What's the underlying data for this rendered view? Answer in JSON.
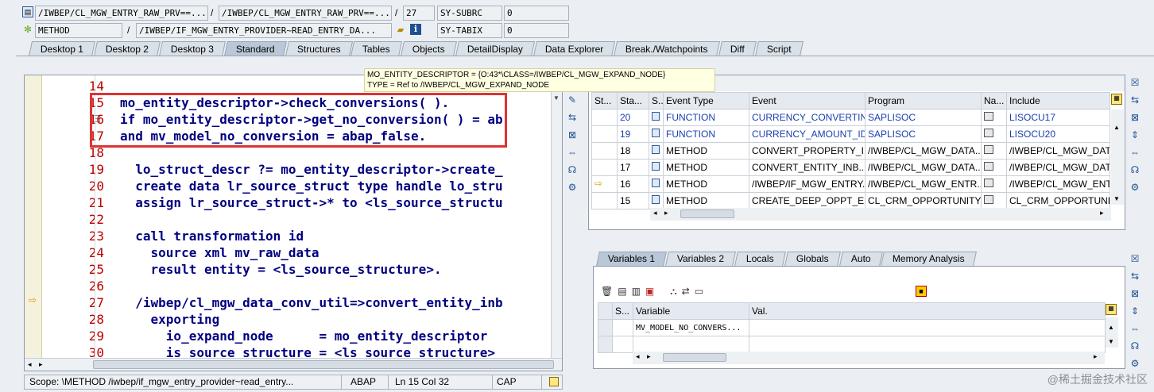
{
  "header": {
    "row1": {
      "program": "/IWBEP/CL_MGW_ENTRY_RAW_PRV==...",
      "include": "/IWBEP/CL_MGW_ENTRY_RAW_PRV==...",
      "line": "27",
      "sysvar": "SY-SUBRC",
      "sysval": "0"
    },
    "row2": {
      "type": "METHOD",
      "name": "/IWBEP/IF_MGW_ENTRY_PROVIDER~READ_ENTRY_DA...",
      "sysvar": "SY-TABIX",
      "sysval": "0"
    },
    "slash": "/"
  },
  "tabs": [
    "Desktop 1",
    "Desktop 2",
    "Desktop 3",
    "Standard",
    "Structures",
    "Tables",
    "Objects",
    "DetailDisplay",
    "Data Explorer",
    "Break./Watchpoints",
    "Diff",
    "Script"
  ],
  "tooltip": {
    "line1": "MO_ENTITY_DESCRIPTOR = {O:43*\\CLASS=/IWBEP/CL_MGW_EXPAND_NODE}",
    "line2": "TYPE  = Ref to /IWBEP/CL_MGW_EXPAND_NODE"
  },
  "code": [
    {
      "n": "14",
      "t": ""
    },
    {
      "n": "15",
      "t": "mo_entity_descriptor->check_conversions( )."
    },
    {
      "n": "16",
      "t": "if mo_entity_descriptor->get_no_conversion( ) = ab"
    },
    {
      "n": "17",
      "t": "and mv_model_no_conversion = abap_false."
    },
    {
      "n": "18",
      "t": ""
    },
    {
      "n": "19",
      "t": "  lo_struct_descr ?= mo_entity_descriptor->create_"
    },
    {
      "n": "20",
      "t": "  create data lr_source_struct type handle lo_stru"
    },
    {
      "n": "21",
      "t": "  assign lr_source_struct->* to <ls_source_structu"
    },
    {
      "n": "22",
      "t": ""
    },
    {
      "n": "23",
      "t": "  call transformation id"
    },
    {
      "n": "24",
      "t": "    source xml mv_raw_data"
    },
    {
      "n": "25",
      "t": "    result entity = <ls_source_structure>."
    },
    {
      "n": "26",
      "t": ""
    },
    {
      "n": "27",
      "t": "  /iwbep/cl_mgw_data_conv_util=>convert_entity_inb"
    },
    {
      "n": "28",
      "t": "    exporting"
    },
    {
      "n": "29",
      "t": "      io_expand_node      = mo_entity_descriptor"
    },
    {
      "n": "30",
      "t": "      is_source_structure = <ls_source_structure>"
    }
  ],
  "callstack": {
    "headers": [
      "St...",
      "Sta...",
      "S...",
      "Event Type",
      "Event",
      "Program",
      "Na...",
      "Include"
    ],
    "rows": [
      {
        "level": "20",
        "etype": "FUNCTION",
        "event": "CURRENCY_CONVERTIN...",
        "program": "SAPLISOC",
        "include": "LISOCU17",
        "link": true
      },
      {
        "level": "19",
        "etype": "FUNCTION",
        "event": "CURRENCY_AMOUNT_ID...",
        "program": "SAPLISOC",
        "include": "LISOCU20",
        "link": true
      },
      {
        "level": "18",
        "etype": "METHOD",
        "event": "CONVERT_PROPERTY_I...",
        "program": "/IWBEP/CL_MGW_DATA...",
        "include": "/IWBEP/CL_MGW_DAT",
        "link": false
      },
      {
        "level": "17",
        "etype": "METHOD",
        "event": "CONVERT_ENTITY_INB...",
        "program": "/IWBEP/CL_MGW_DATA...",
        "include": "/IWBEP/CL_MGW_DAT",
        "link": false
      },
      {
        "level": "16",
        "etype": "METHOD",
        "event": "/IWBEP/IF_MGW_ENTRY...",
        "program": "/IWBEP/CL_MGW_ENTR...",
        "include": "/IWBEP/CL_MGW_ENT",
        "link": false,
        "current": true
      },
      {
        "level": "15",
        "etype": "METHOD",
        "event": "CREATE_DEEP_OPPT_E...",
        "program": "CL_CRM_OPPORTUNITY...",
        "include": "CL_CRM_OPPORTUNIT",
        "link": false
      }
    ]
  },
  "vartabs": [
    "Variables 1",
    "Variables 2",
    "Locals",
    "Globals",
    "Auto",
    "Memory Analysis"
  ],
  "variables": {
    "headers": [
      "S...",
      "Variable",
      "Val."
    ],
    "rows": [
      {
        "name": "MV_MODEL_NO_CONVERS...",
        "value": ""
      }
    ]
  },
  "status": {
    "scope": "Scope: \\METHOD /iwbep/if_mgw_entry_provider~read_entry...",
    "lang": "ABAP",
    "pos": "Ln  15 Col  32",
    "caps": "CAP"
  },
  "watermark": "@稀土掘金技术社区",
  "colors": {
    "accent": "#1e4f8f",
    "keyword": "#000080",
    "linenum": "#b00000",
    "highlight": "#dd3333",
    "link": "#1a3fb0"
  }
}
